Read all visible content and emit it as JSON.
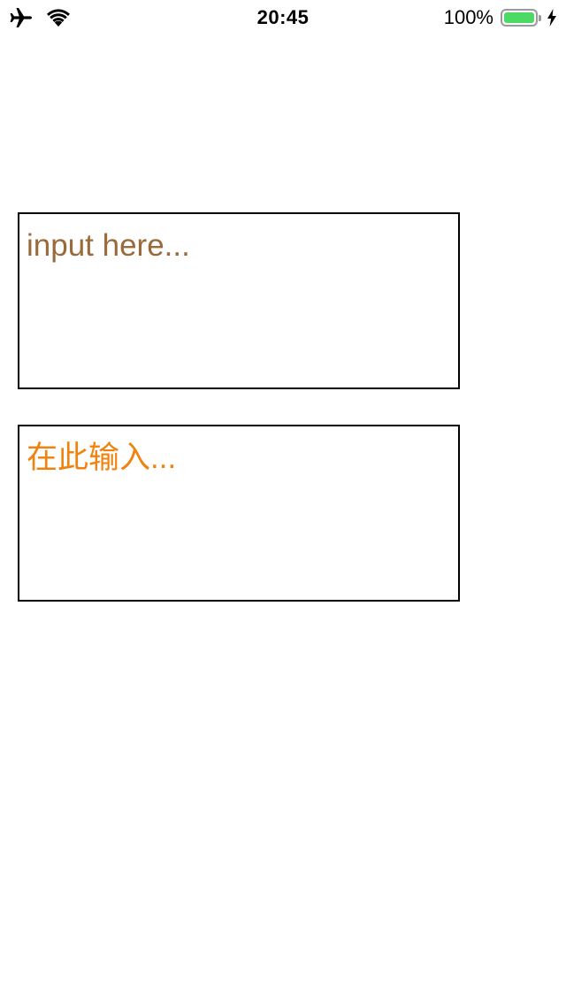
{
  "status_bar": {
    "time": "20:45",
    "battery_percent": "100%",
    "battery_level": 1.0,
    "battery_color": "#4cd964",
    "icons": [
      "airplane-icon",
      "wifi-icon",
      "battery-icon",
      "charging-icon"
    ]
  },
  "inputs": [
    {
      "placeholder": "input here...",
      "value": "",
      "placeholder_color": "#9a6a3a"
    },
    {
      "placeholder": "在此输入...",
      "value": "",
      "placeholder_color": "#f0820f"
    }
  ]
}
